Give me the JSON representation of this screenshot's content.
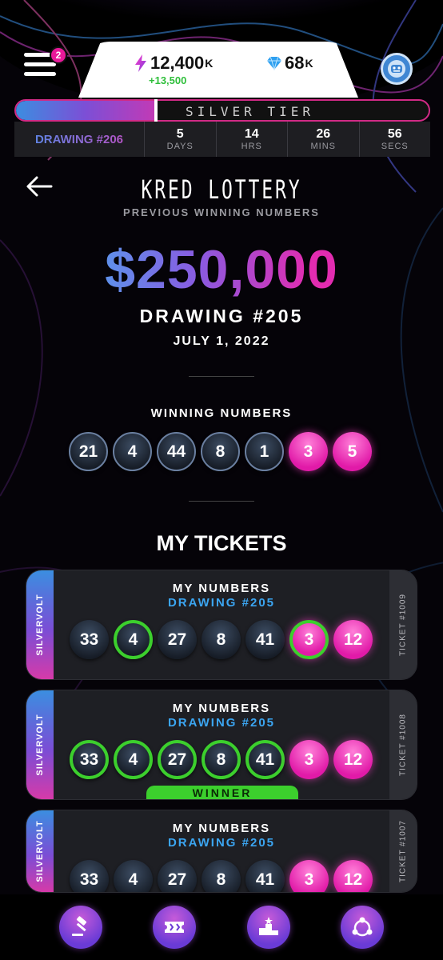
{
  "topbar": {
    "menu_badge": "2",
    "volts": {
      "value": "12,400",
      "suffix": "K",
      "gain": "+13,500"
    },
    "gems": {
      "value": "68",
      "suffix": "K"
    }
  },
  "tier": {
    "label": "SILVER TIER",
    "progress": 0.335
  },
  "countdown": {
    "drawing": "DRAWING #206",
    "cells": [
      {
        "value": "5",
        "unit": "DAYS"
      },
      {
        "value": "14",
        "unit": "HRS"
      },
      {
        "value": "26",
        "unit": "MINS"
      },
      {
        "value": "56",
        "unit": "SECS"
      }
    ]
  },
  "header": {
    "title": "KRED LOTTERY",
    "subtitle": "PREVIOUS WINNING NUMBERS",
    "amount": "$250,000",
    "drawing": "DRAWING #205",
    "date": "JULY 1, 2022",
    "winning_label": "WINNING NUMBERS"
  },
  "winning_numbers": {
    "main": [
      "21",
      "4",
      "44",
      "8",
      "1"
    ],
    "bonus": [
      "3",
      "5"
    ]
  },
  "my_tickets_title": "MY TICKETS",
  "tickets": [
    {
      "brand": "SILVERVOLT",
      "heading": "MY NUMBERS",
      "drawing": "DRAWING #205",
      "ticket": "TICKET #1009",
      "numbers": [
        "33",
        "4",
        "27",
        "8",
        "41",
        "3",
        "12"
      ],
      "matched": [
        false,
        true,
        false,
        false,
        false,
        true,
        false
      ],
      "winner": ""
    },
    {
      "brand": "SILVERVOLT",
      "heading": "MY NUMBERS",
      "drawing": "DRAWING #205",
      "ticket": "TICKET #1008",
      "numbers": [
        "33",
        "4",
        "27",
        "8",
        "41",
        "3",
        "12"
      ],
      "matched": [
        true,
        true,
        true,
        true,
        true,
        false,
        false
      ],
      "winner": "WINNER"
    },
    {
      "brand": "SILVERVOLT",
      "heading": "MY NUMBERS",
      "drawing": "DRAWING #205",
      "ticket": "TICKET #1007",
      "numbers": [
        "33",
        "4",
        "27",
        "8",
        "41",
        "3",
        "12"
      ],
      "matched": [
        false,
        false,
        false,
        false,
        false,
        false,
        false
      ],
      "winner": ""
    }
  ],
  "nav": [
    "gavel-icon",
    "ticket-icon",
    "podium-icon",
    "community-icon"
  ],
  "colors": {
    "accent_pink": "#e11aa8",
    "accent_blue": "#3ba5f1",
    "match_green": "#3ccf2d"
  }
}
